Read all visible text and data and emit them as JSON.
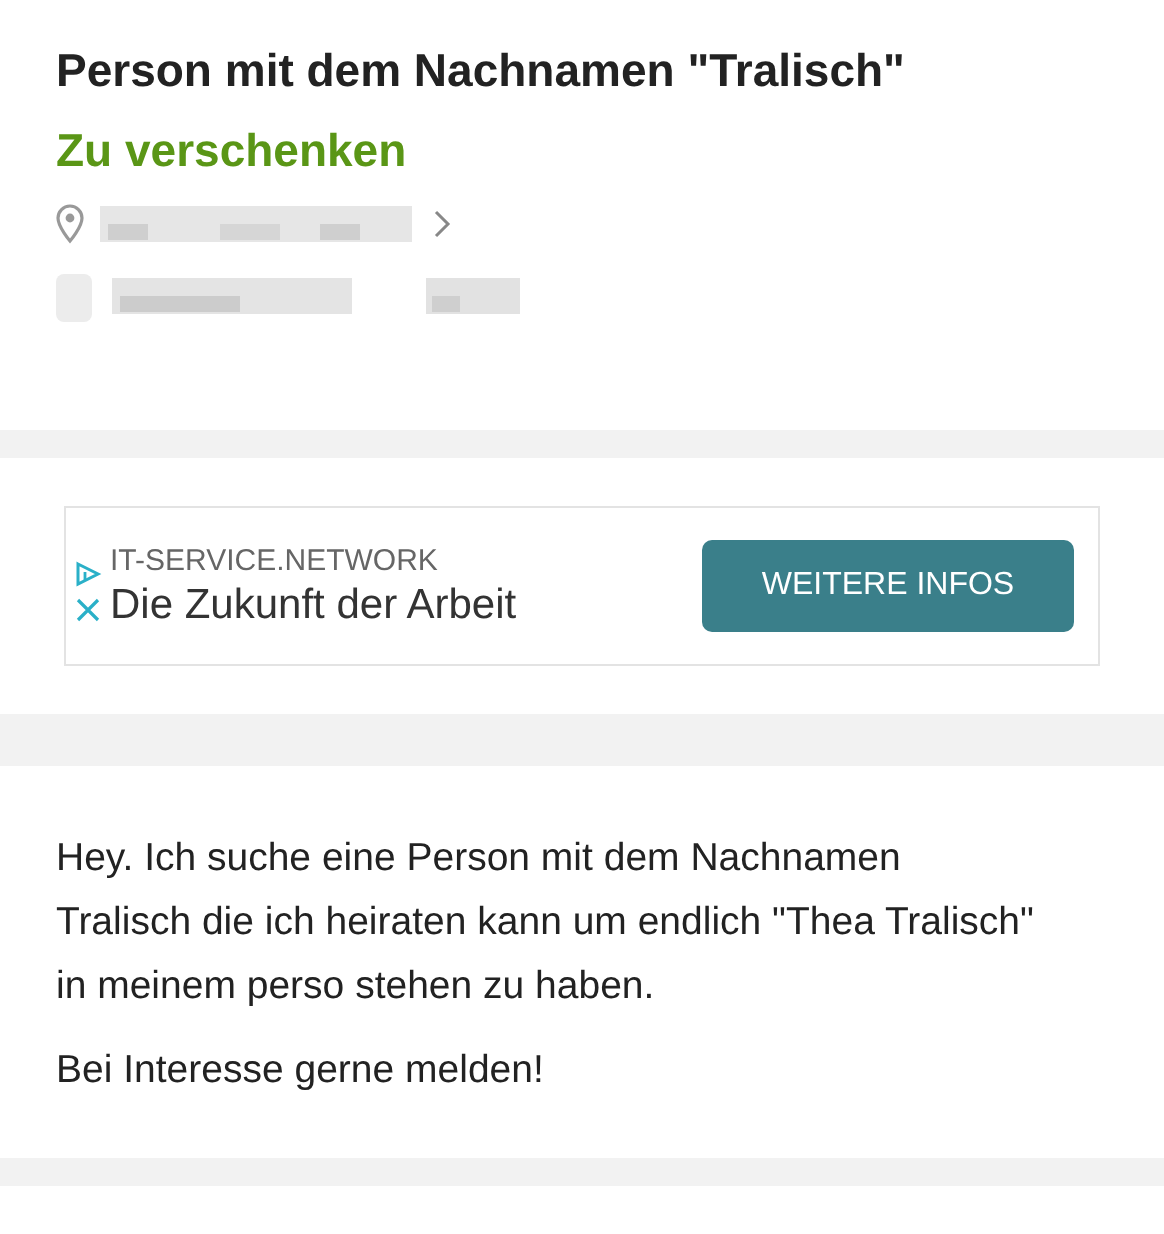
{
  "listing": {
    "title": "Person mit dem Nachnamen \"Tralisch\"",
    "price": "Zu verschenken"
  },
  "ad": {
    "domain": "IT-SERVICE.NETWORK",
    "headline": "Die Zukunft der Arbeit",
    "button": "WEITERE INFOS"
  },
  "description": [
    "Hey. Ich suche eine Person mit dem Nachnamen Tralisch die ich heiraten kann um endlich \"Thea Tralisch\" in meinem perso stehen zu haben.",
    "Bei Interesse gerne melden!"
  ]
}
